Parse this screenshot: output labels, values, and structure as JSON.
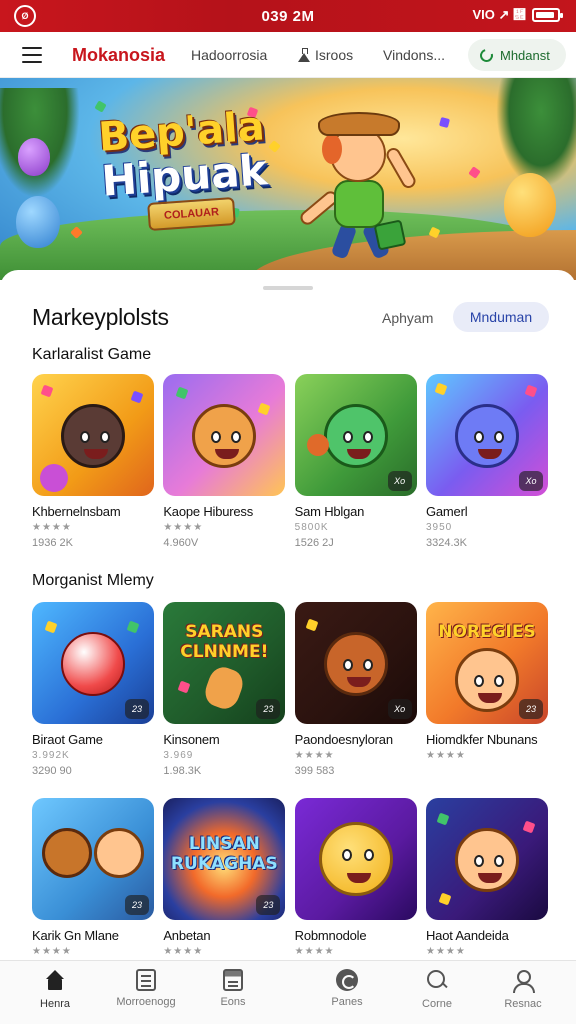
{
  "status_bar": {
    "app_logo": "Ø",
    "time": "039 2M",
    "indicators": "VIO ↗ ὞",
    "battery_level": 0.75
  },
  "top_nav": {
    "brand": "Mokanosia",
    "links": [
      "Hadoorrosia",
      "Isroos",
      "Vindons..."
    ],
    "action_label": "Mhdanst"
  },
  "hero": {
    "title_line1": "Bep'ala",
    "title_line2": "Hipuak",
    "tag": "COLAUAR"
  },
  "sheet": {
    "title": "Markeyplolsts",
    "segment_inactive": "Aphyam",
    "segment_active": "Mnduman",
    "sections": [
      "Karlaralist Game",
      "Morganist Mlemy"
    ]
  },
  "rows": [
    [
      {
        "name": "Khbernelnsbam",
        "rating": "★★★★",
        "meta": "1936 2K",
        "badge": "",
        "thumb_text": ""
      },
      {
        "name": "Kaope Hiburess",
        "rating": "★★★★",
        "meta": "4.960V",
        "badge": "",
        "thumb_text": ""
      },
      {
        "name": "Sam Hblgan",
        "rating": "5800K",
        "meta": "1526 2J",
        "badge": "Xo",
        "thumb_text": ""
      },
      {
        "name": "Gamerl",
        "rating": "3950",
        "meta": "3324.3K",
        "badge": "Xo",
        "thumb_text": ""
      }
    ],
    [
      {
        "name": "Biraot Game",
        "rating": "3.992K",
        "meta": "3290 90",
        "badge": "23",
        "thumb_text": ""
      },
      {
        "name": "Kinsonem",
        "rating": "3.969",
        "meta": "1.98.3K",
        "badge": "23",
        "thumb_text": "SARANS CLNNME!"
      },
      {
        "name": "Paondoesnyloran",
        "rating": "★★★★",
        "meta": "399 583",
        "badge": "Xo",
        "thumb_text": ""
      },
      {
        "name": "Hiomdkfer Nbunans",
        "rating": "★★★★",
        "meta": "",
        "badge": "23",
        "thumb_text": "NOREGIES"
      }
    ],
    [
      {
        "name": "Karik Gn Mlane",
        "rating": "★★★★",
        "meta": "",
        "badge": "23",
        "thumb_text": ""
      },
      {
        "name": "Anbetan",
        "rating": "★★★★",
        "meta": "",
        "badge": "23",
        "thumb_text": "LINSAN RUKAGHAS"
      },
      {
        "name": "Robmnodole",
        "rating": "★★★★",
        "meta": "",
        "badge": "",
        "thumb_text": ""
      },
      {
        "name": "Haot Aandeida",
        "rating": "★★★★",
        "meta": "",
        "badge": "",
        "thumb_text": ""
      }
    ]
  ],
  "bottom_nav": [
    {
      "label": "Henra",
      "icon": "home-icon"
    },
    {
      "label": "Morroenogg",
      "icon": "document-icon"
    },
    {
      "label": "Eons",
      "icon": "card-icon"
    },
    {
      "label": "Panes",
      "icon": "game-icon"
    },
    {
      "label": "Corne",
      "icon": "search-icon"
    },
    {
      "label": "Resnac",
      "icon": "profile-icon"
    }
  ],
  "colors": {
    "accent_red": "#c8161d",
    "segment_active_text": "#2944a8",
    "action_green": "#1d8a39"
  }
}
